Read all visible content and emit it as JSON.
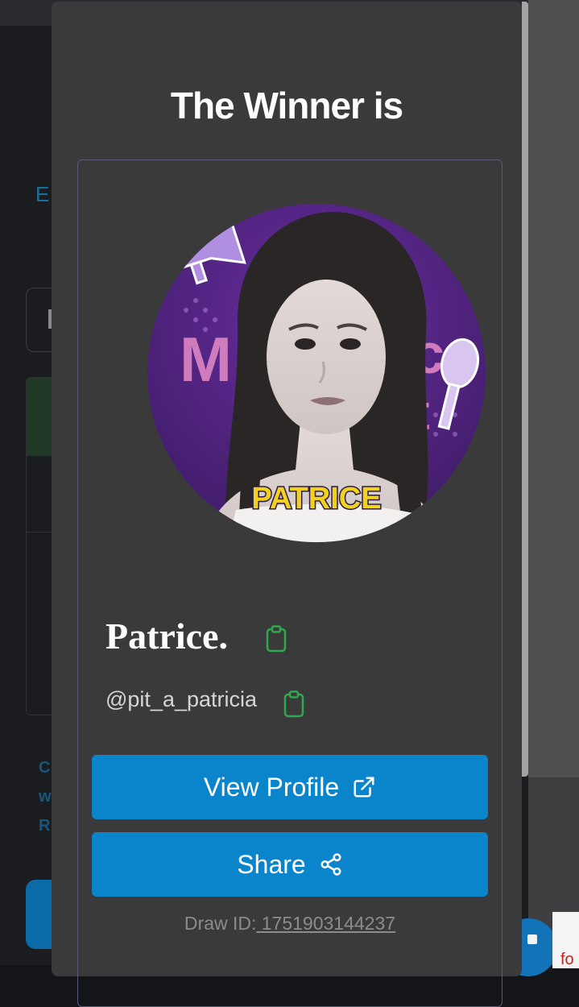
{
  "modal": {
    "title": "The Winner is",
    "winner": {
      "display_name": "Patrice.",
      "handle": "@pit_a_patricia",
      "avatar_caption": "PATRICE"
    },
    "buttons": {
      "view_profile": "View Profile",
      "share": "Share"
    },
    "draw_id": {
      "label": "Draw ID:",
      "value": " 1751903144237"
    }
  },
  "background": {
    "link_fragment": "E",
    "side_text": [
      "C",
      "w",
      "R"
    ],
    "corner_text": "fo"
  },
  "colors": {
    "modal_bg": "#3a3a3b",
    "button_blue": "#0a84ca",
    "copy_icon_green": "#2fa84f",
    "card_border": "#575b78"
  },
  "icons": {
    "copy_name": "clipboard-icon",
    "copy_handle": "clipboard-icon",
    "view_profile": "external-link-icon",
    "share": "share-icon"
  }
}
